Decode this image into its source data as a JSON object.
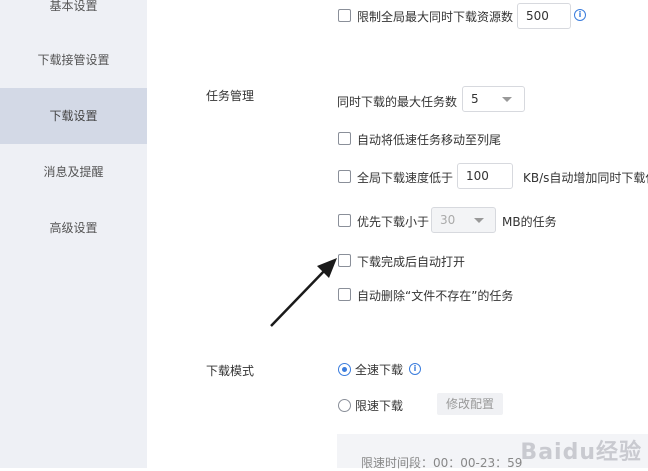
{
  "sidebar": {
    "items": [
      {
        "label": "基本设置"
      },
      {
        "label": "下载接管设置"
      },
      {
        "label": "下载设置",
        "active": true
      },
      {
        "label": "消息及提醒"
      },
      {
        "label": "高级设置"
      }
    ]
  },
  "resource_limit": {
    "label": "限制全局最大同时下载资源数",
    "value": "500",
    "checked": false,
    "icon": "info-icon"
  },
  "task_management": {
    "section_label": "任务管理",
    "max_tasks_label": "同时下载的最大任务数",
    "max_tasks_value": "5",
    "move_slow_label": "自动将低速任务移动至列尾",
    "speed_low_label": "全局下载速度低于",
    "speed_low_value": "100",
    "speed_low_suffix": "KB/s自动增加同时下载任",
    "priority_label": "优先下载小于",
    "priority_value": "30",
    "priority_suffix": "MB的任务",
    "auto_open_label": "下载完成后自动打开",
    "auto_delete_label": "自动删除“文件不存在”的任务"
  },
  "download_mode": {
    "section_label": "下载模式",
    "full_speed_label": "全速下载",
    "limited_label": "限速下载",
    "modify_button": "修改配置",
    "time_range": "限速时间段：00：00-23：59",
    "selected": "full_speed"
  },
  "colors": {
    "accent": "#3b7ddd",
    "sidebar_bg": "#eef0f5",
    "sidebar_active": "#d3d9e6"
  },
  "watermark": "Baidu经验"
}
